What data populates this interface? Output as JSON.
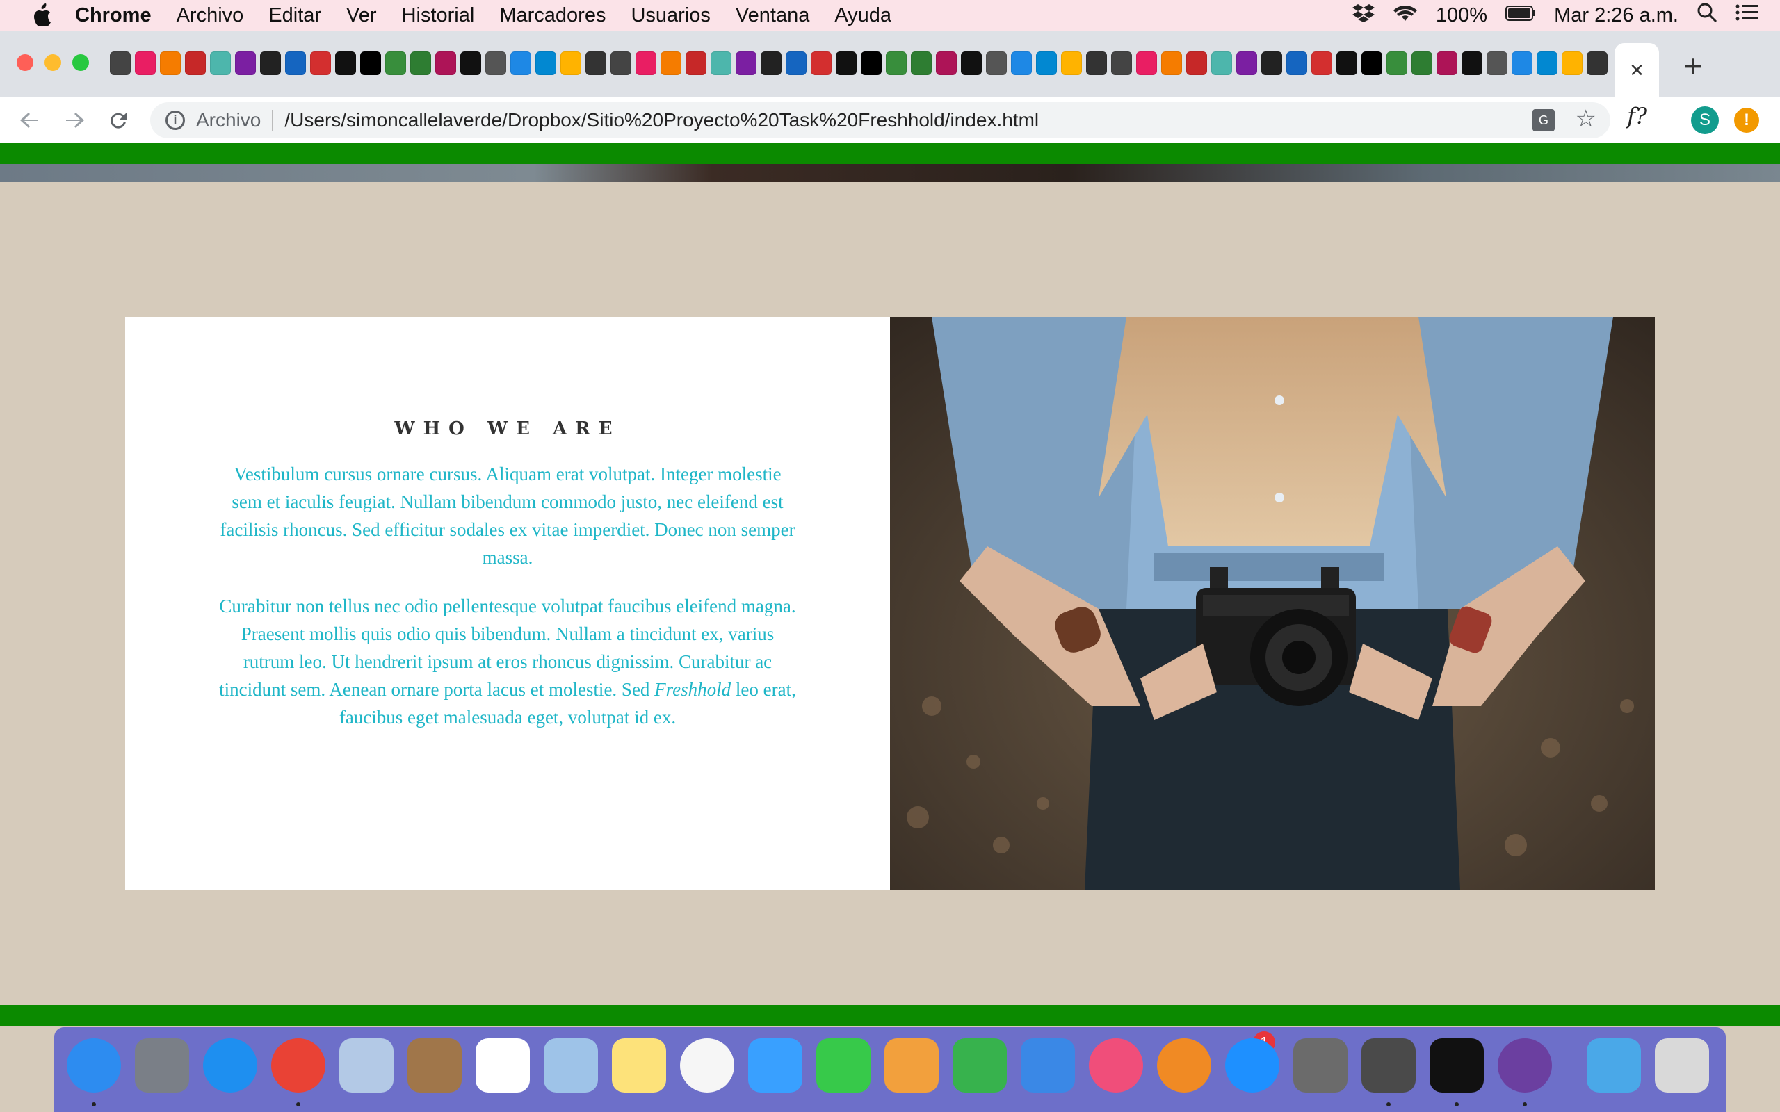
{
  "menubar": {
    "app": "Chrome",
    "items": [
      "Archivo",
      "Editar",
      "Ver",
      "Historial",
      "Marcadores",
      "Usuarios",
      "Ventana",
      "Ayuda"
    ],
    "battery": "100%",
    "clock": "Mar 2:26 a.m."
  },
  "browser": {
    "active_tab_close": "×",
    "new_tab": "+",
    "scheme": "Archivo",
    "url": "/Users/simoncallelaverde/Dropbox/Sitio%20Proyecto%20Task%20Freshhold/index.html",
    "fx_label": "f?",
    "profile_initial": "S",
    "alert_label": "!"
  },
  "about": {
    "heading": "WHO WE ARE",
    "paragraph1": "Vestibulum cursus ornare cursus. Aliquam erat volutpat. Integer molestie sem et iaculis feugiat. Nullam bibendum commodo justo, nec eleifend est facilisis rhoncus. Sed efficitur sodales ex vitae imperdiet. Donec non semper massa.",
    "paragraph2_before": "Curabitur non tellus nec odio pellentesque volutpat faucibus eleifend magna. Praesent mollis quis odio quis bibendum. Nullam a tincidunt ex, varius rutrum leo. Ut hendrerit ipsum at eros rhoncus dignissim. Curabitur ac tincidunt sem. Aenean ornare porta lacus et molestie. Sed ",
    "paragraph2_em": "Freshhold",
    "paragraph2_after": " leo erat, faucibus eget malesuada eget, volutpat id ex."
  },
  "dock": {
    "apps": [
      "finder-icon",
      "launchpad-icon",
      "safari-icon",
      "chrome-icon",
      "mail-icon",
      "contacts-icon",
      "reminders-icon",
      "preview-icon",
      "notes-icon",
      "photos-icon",
      "messages-icon",
      "facetime-icon",
      "pages-icon",
      "numbers-icon",
      "keynote-icon",
      "itunes-icon",
      "ibooks-icon",
      "app-store-icon",
      "system-preferences-icon",
      "sublime-text-icon",
      "terminal-icon",
      "github-desktop-icon",
      "downloads-icon",
      "trash-icon"
    ],
    "app_store_badge": "1"
  },
  "colors": {
    "page_bg": "#d6cbbb",
    "accent_green": "#0b8a00",
    "text_teal": "#1fb6c7",
    "heading": "#333333"
  }
}
